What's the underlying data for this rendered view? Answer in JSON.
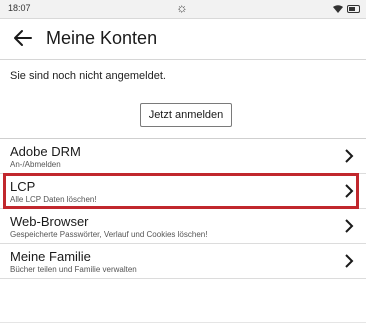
{
  "status_bar": {
    "time": "18:07",
    "center_icon": "sun-icon",
    "icons": [
      "wifi-icon",
      "battery-icon"
    ]
  },
  "header": {
    "back_icon": "arrow-left-icon",
    "title": "Meine Konten"
  },
  "account_notice": {
    "text": "Sie sind noch nicht angemeldet.",
    "login_button_label": "Jetzt anmelden"
  },
  "list": {
    "items": [
      {
        "title": "Adobe DRM",
        "subtitle": "An-/Abmelden",
        "icon": "chevron-right-icon"
      },
      {
        "title": "LCP",
        "subtitle": "Alle LCP Daten löschen!",
        "icon": "chevron-right-icon",
        "highlighted": true
      },
      {
        "title": "Web-Browser",
        "subtitle": "Gespeicherte Passwörter, Verlauf und Cookies löschen!",
        "icon": "chevron-right-icon"
      },
      {
        "title": "Meine Familie",
        "subtitle": "Bücher teilen und Familie verwalten",
        "icon": "chevron-right-icon"
      }
    ]
  },
  "colors": {
    "highlight_border": "#c1272d",
    "text": "#1a1a1a",
    "status_bar_bg": "#f2f2f2"
  }
}
